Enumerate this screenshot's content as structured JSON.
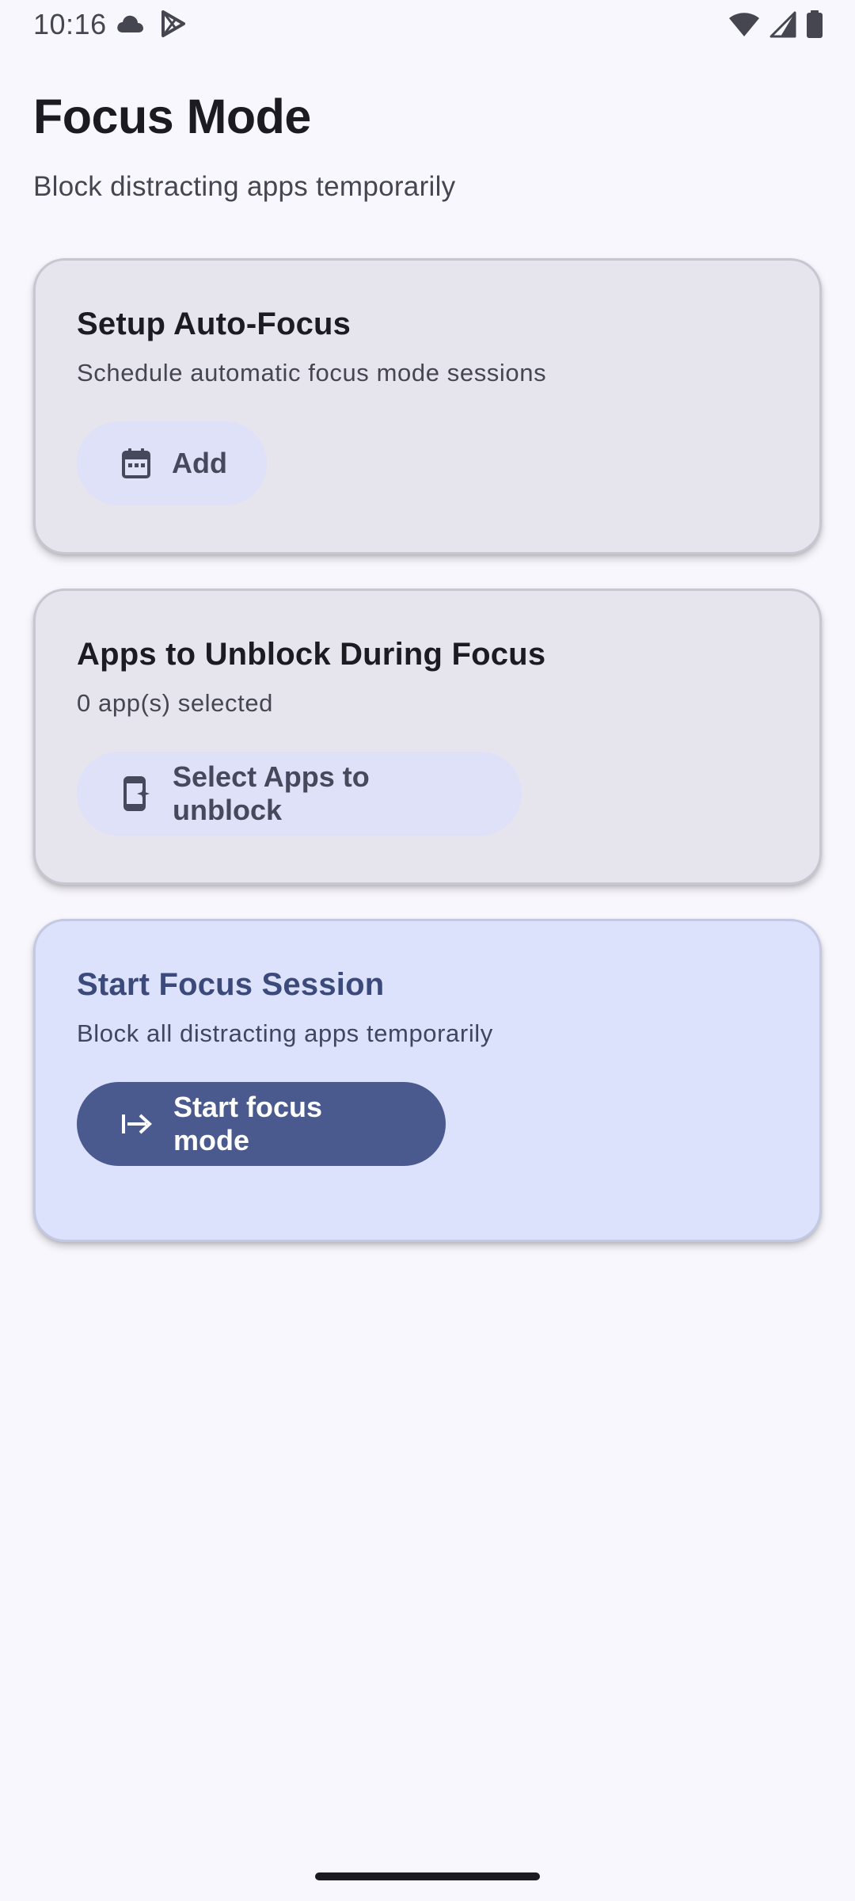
{
  "status_bar": {
    "time": "10:16",
    "left_icons": [
      "cloud-icon",
      "play-store-icon"
    ],
    "right_icons": [
      "wifi-icon",
      "signal-icon",
      "battery-icon"
    ]
  },
  "header": {
    "title": "Focus Mode",
    "subtitle": "Block distracting apps temporarily"
  },
  "cards": {
    "auto_focus": {
      "title": "Setup Auto-Focus",
      "description": "Schedule automatic focus mode sessions",
      "button_label": "Add",
      "button_icon": "calendar-icon"
    },
    "unblock_apps": {
      "title": "Apps to Unblock During Focus",
      "description": "0 app(s) selected",
      "button_label": "Select Apps to unblock",
      "button_icon": "app-select-icon"
    },
    "start_session": {
      "title": "Start Focus Session",
      "description": "Block all distracting apps temporarily",
      "button_label": "Start focus mode",
      "button_icon": "start-arrow-icon"
    }
  },
  "colors": {
    "background": "#f8f7fd",
    "card_surface": "#e6e5ee",
    "card_primary": "#dce1fc",
    "tonal_button": "#dee1f7",
    "filled_button": "#4a5a8f",
    "primary_text": "#3b4a7a"
  }
}
